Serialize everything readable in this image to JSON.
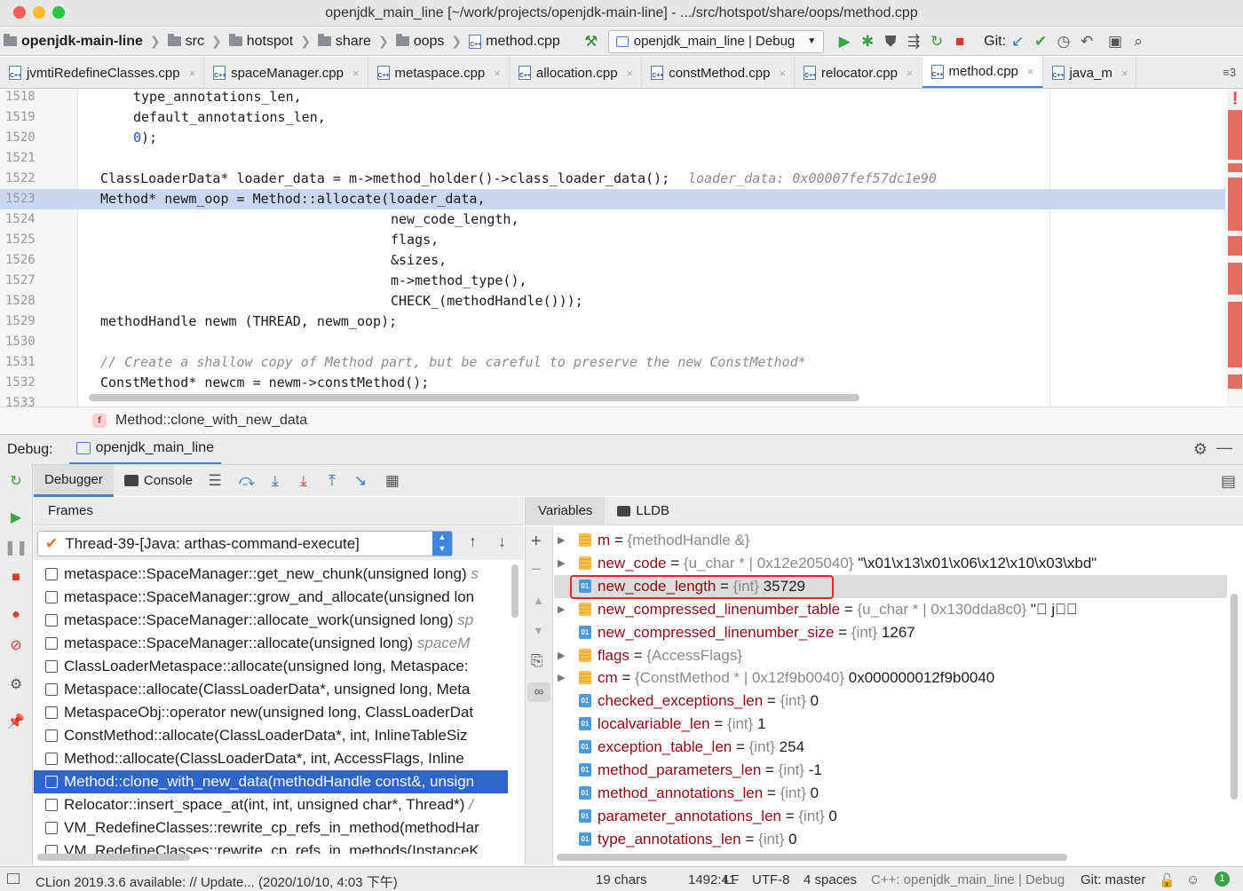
{
  "window": {
    "title": "openjdk_main_line [~/work/projects/openjdk-main-line] - .../src/hotspot/share/oops/method.cpp"
  },
  "breadcrumb": {
    "project": "openjdk-main-line",
    "items": [
      "src",
      "hotspot",
      "share",
      "oops"
    ],
    "file": "method.cpp"
  },
  "run_config": {
    "label": "openjdk_main_line | Debug"
  },
  "vcs": {
    "label": "Git:"
  },
  "tabs": [
    {
      "label": "jvmtiRedefineClasses.cpp",
      "active": false
    },
    {
      "label": "spaceManager.cpp",
      "active": false
    },
    {
      "label": "metaspace.cpp",
      "active": false
    },
    {
      "label": "allocation.cpp",
      "active": false
    },
    {
      "label": "constMethod.cpp",
      "active": false
    },
    {
      "label": "relocator.cpp",
      "active": false
    },
    {
      "label": "method.cpp",
      "active": true
    },
    {
      "label": "java_m",
      "active": false
    }
  ],
  "tabs_overflow": "≡3",
  "editor": {
    "lines": [
      {
        "num": "1518",
        "code": "type_annotations_len,",
        "indent": 2
      },
      {
        "num": "1519",
        "code": "default_annotations_len,",
        "indent": 2
      },
      {
        "num": "1520",
        "code": "0);",
        "indent": 2
      },
      {
        "num": "1521",
        "code": "",
        "indent": 1
      },
      {
        "num": "1522",
        "code": "ClassLoaderData* loader_data = m->method_holder()->class_loader_data();",
        "indent": 1,
        "inline_value": "loader_data: 0x00007fef57dc1e90"
      },
      {
        "num": "1523",
        "code": "Method* newm_oop = Method::allocate(loader_data,",
        "indent": 1,
        "highlighted": true
      },
      {
        "num": "1524",
        "code": "new_code_length,",
        "indent": 3
      },
      {
        "num": "1525",
        "code": "flags,",
        "indent": 3
      },
      {
        "num": "1526",
        "code": "&sizes,",
        "indent": 3
      },
      {
        "num": "1527",
        "code": "m->method_type(),",
        "indent": 3
      },
      {
        "num": "1528",
        "code": "CHECK_(methodHandle()));",
        "indent": 3
      },
      {
        "num": "1529",
        "code": "methodHandle newm (THREAD, newm_oop);",
        "indent": 1
      },
      {
        "num": "1530",
        "code": "",
        "indent": 1
      },
      {
        "num": "1531",
        "code": "// Create a shallow copy of Method part, but be careful to preserve the new ConstMethod*",
        "indent": 1,
        "comment": true
      },
      {
        "num": "1532",
        "code": "ConstMethod* newcm = newm->constMethod();",
        "indent": 1
      },
      {
        "num": "1533",
        "code": "",
        "indent": 1
      }
    ]
  },
  "function_breadcrumb": {
    "icon": "f",
    "label": "Method::clone_with_new_data"
  },
  "debug": {
    "title": "Debug:",
    "session_tab": "openjdk_main_line",
    "tabs": {
      "debugger": "Debugger",
      "console": "Console"
    },
    "frames": {
      "header": "Frames",
      "thread": "Thread-39-[Java: arthas-command-execute]",
      "items": [
        {
          "fn": "metaspace::SpaceManager::get_new_chunk(unsigned long)",
          "file": " s"
        },
        {
          "fn": "metaspace::SpaceManager::grow_and_allocate(unsigned lon",
          "file": ""
        },
        {
          "fn": "metaspace::SpaceManager::allocate_work(unsigned long)",
          "file": " sp"
        },
        {
          "fn": "metaspace::SpaceManager::allocate(unsigned long)",
          "file": " spaceM"
        },
        {
          "fn": "ClassLoaderMetaspace::allocate(unsigned long, Metaspace:",
          "file": ""
        },
        {
          "fn": "Metaspace::allocate(ClassLoaderData*, unsigned long, Meta",
          "file": ""
        },
        {
          "fn": "MetaspaceObj::operator new(unsigned long, ClassLoaderDat",
          "file": ""
        },
        {
          "fn": "ConstMethod::allocate(ClassLoaderData*, int, InlineTableSiz",
          "file": ""
        },
        {
          "fn": "Method::allocate(ClassLoaderData*, int, AccessFlags, Inline",
          "file": ""
        },
        {
          "fn": "Method::clone_with_new_data(methodHandle const&, unsign",
          "file": "",
          "selected": true
        },
        {
          "fn": "Relocator::insert_space_at(int, int, unsigned char*, Thread*)",
          "file": " /"
        },
        {
          "fn": "VM_RedefineClasses::rewrite_cp_refs_in_method(methodHar",
          "file": ""
        },
        {
          "fn": "VM_RedefineClasses::rewrite_cp_refs_in_methods(InstanceK",
          "file": ""
        }
      ]
    },
    "variables": {
      "tabs": {
        "variables": "Variables",
        "lldb": "LLDB"
      },
      "items": [
        {
          "name": "m",
          "type": "{methodHandle &}",
          "value": "",
          "expandable": true,
          "kind": "obj"
        },
        {
          "name": "new_code",
          "type": "{u_char * | 0x12e205040}",
          "value": "\"\\x01\\x13\\x01\\x06\\x12\\x10\\x03\\xbd\"",
          "expandable": true,
          "kind": "obj"
        },
        {
          "name": "new_code_length",
          "type": "{int}",
          "value": "35729",
          "expandable": false,
          "kind": "prim",
          "selected": true
        },
        {
          "name": "new_compressed_linenumber_table",
          "type": "{u_char * | 0x130dda8c0}",
          "value": "\"\u0000 j\u0000\u0000",
          "expandable": true,
          "kind": "obj"
        },
        {
          "name": "new_compressed_linenumber_size",
          "type": "{int}",
          "value": "1267",
          "expandable": false,
          "kind": "prim"
        },
        {
          "name": "flags",
          "type": "{AccessFlags}",
          "value": "",
          "expandable": true,
          "kind": "obj"
        },
        {
          "name": "cm",
          "type": "{ConstMethod * | 0x12f9b0040}",
          "value": "0x000000012f9b0040",
          "expandable": true,
          "kind": "obj"
        },
        {
          "name": "checked_exceptions_len",
          "type": "{int}",
          "value": "0",
          "expandable": false,
          "kind": "prim"
        },
        {
          "name": "localvariable_len",
          "type": "{int}",
          "value": "1",
          "expandable": false,
          "kind": "prim"
        },
        {
          "name": "exception_table_len",
          "type": "{int}",
          "value": "254",
          "expandable": false,
          "kind": "prim"
        },
        {
          "name": "method_parameters_len",
          "type": "{int}",
          "value": "-1",
          "expandable": false,
          "kind": "prim"
        },
        {
          "name": "method_annotations_len",
          "type": "{int}",
          "value": "0",
          "expandable": false,
          "kind": "prim"
        },
        {
          "name": "parameter_annotations_len",
          "type": "{int}",
          "value": "0",
          "expandable": false,
          "kind": "prim"
        },
        {
          "name": "type_annotations_len",
          "type": "{int}",
          "value": "0",
          "expandable": false,
          "kind": "prim"
        }
      ]
    }
  },
  "status": {
    "message": "CLion 2019.3.6 available: // Update... (2020/10/10, 4:03 下午)",
    "chars": "19 chars",
    "position": "1492:41",
    "line_sep": "LF",
    "encoding": "UTF-8",
    "indent": "4 spaces",
    "context": "C++: openjdk_main_line | Debug",
    "git": "Git: master",
    "notifications": "1"
  },
  "colors": {
    "accent": "#4083c9",
    "selection": "#2f65ca",
    "highlight_line": "#c9d7f0",
    "var_name": "#8b0a14",
    "red_box": "#e02828"
  }
}
